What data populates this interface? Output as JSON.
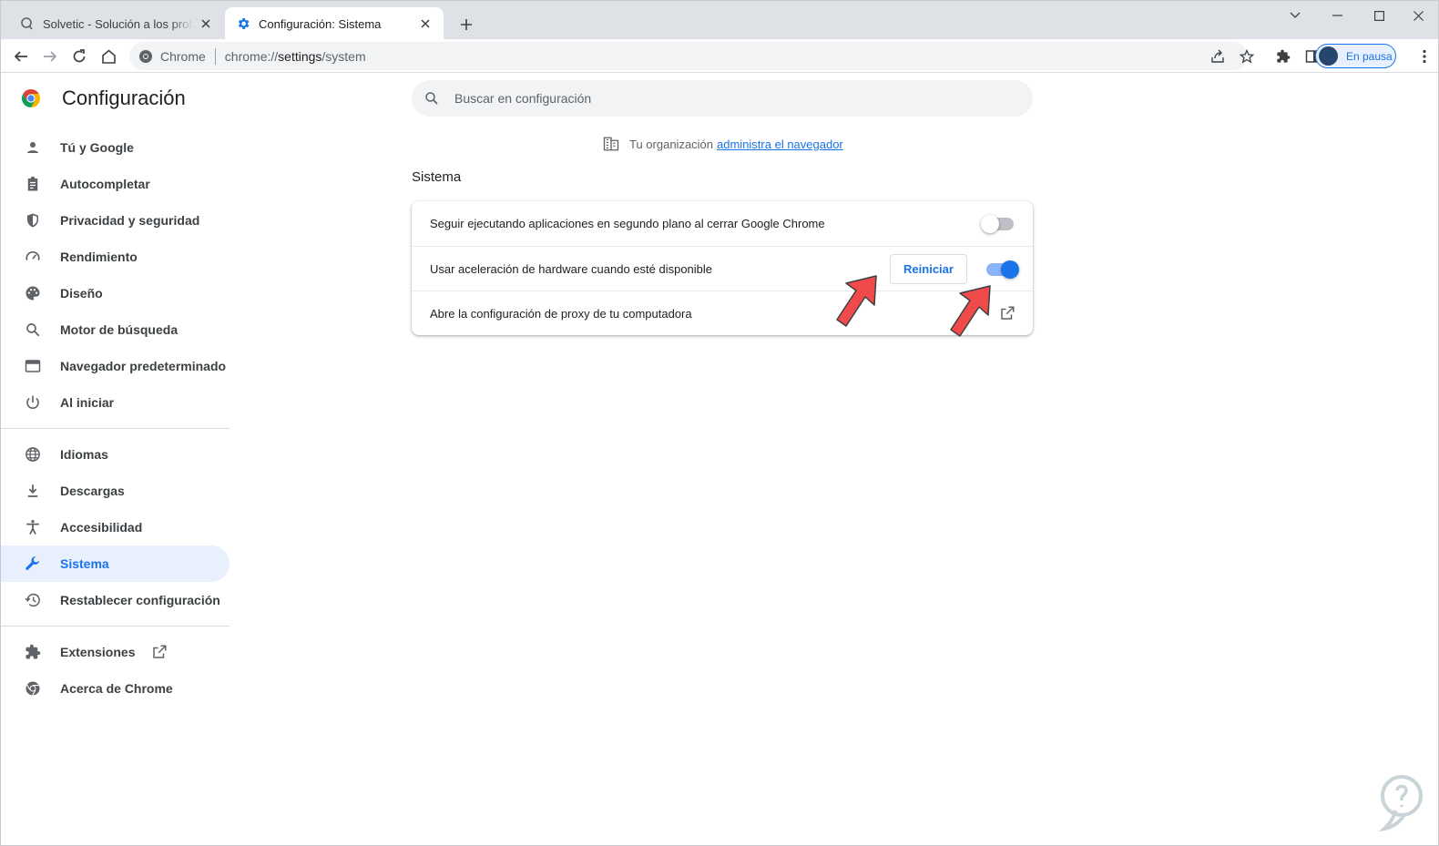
{
  "tabs": [
    {
      "title": "Solvetic - Solución a los problemas",
      "active": false
    },
    {
      "title": "Configuración: Sistema",
      "active": true
    }
  ],
  "toolbar": {
    "site_chip": "Chrome",
    "url_prefix": "chrome://",
    "url_host": "settings",
    "url_path": "/system",
    "profile_label": "En pausa"
  },
  "sidebar": {
    "title": "Configuración",
    "items": [
      {
        "label": "Tú y Google",
        "icon": "person-icon"
      },
      {
        "label": "Autocompletar",
        "icon": "clipboard-icon"
      },
      {
        "label": "Privacidad y seguridad",
        "icon": "shield-icon"
      },
      {
        "label": "Rendimiento",
        "icon": "speedometer-icon"
      },
      {
        "label": "Diseño",
        "icon": "palette-icon"
      },
      {
        "label": "Motor de búsqueda",
        "icon": "search-icon"
      },
      {
        "label": "Navegador predeterminado",
        "icon": "browser-window-icon"
      },
      {
        "label": "Al iniciar",
        "icon": "power-icon"
      },
      {
        "label": "Idiomas",
        "icon": "globe-icon"
      },
      {
        "label": "Descargas",
        "icon": "download-icon"
      },
      {
        "label": "Accesibilidad",
        "icon": "accessibility-icon"
      },
      {
        "label": "Sistema",
        "icon": "wrench-icon",
        "selected": true
      },
      {
        "label": "Restablecer configuración",
        "icon": "history-icon"
      },
      {
        "label": "Extensiones",
        "icon": "puzzle-icon"
      },
      {
        "label": "Acerca de Chrome",
        "icon": "chrome-icon"
      }
    ]
  },
  "main": {
    "search_placeholder": "Buscar en configuración",
    "managed_prefix": "Tu organización",
    "managed_link": "administra el navegador",
    "section_title": "Sistema",
    "rows": [
      {
        "label": "Seguir ejecutando aplicaciones en segundo plano al cerrar Google Chrome",
        "toggle_on": false
      },
      {
        "label": "Usar aceleración de hardware cuando esté disponible",
        "toggle_on": true,
        "button": "Reiniciar"
      },
      {
        "label": "Abre la configuración de proxy de tu computadora"
      }
    ]
  },
  "colors": {
    "accent": "#1a73e8",
    "arrow_fill": "#f14a4a"
  }
}
